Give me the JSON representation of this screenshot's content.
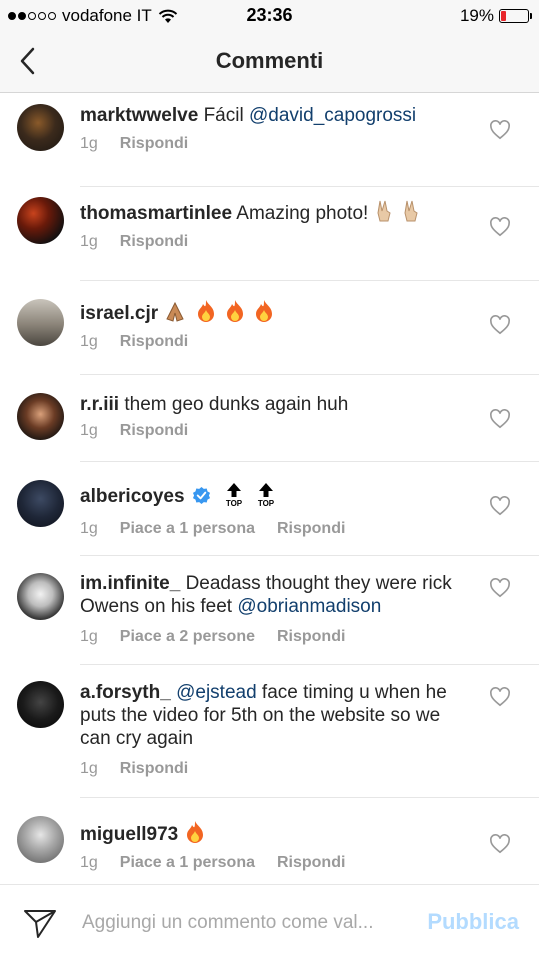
{
  "status_bar": {
    "carrier": "vodafone IT",
    "time": "23:36",
    "battery": "19%",
    "signal_bars": 2,
    "battery_level": 0.19,
    "battery_color": "#e8262b"
  },
  "nav": {
    "title": "Commenti",
    "back_icon": "chevron-left-icon"
  },
  "comments": [
    {
      "username": "marktwwelve",
      "text": "Fácil ",
      "mention": "@david_capogrossi",
      "time": "1g",
      "reply": "Rispondi"
    },
    {
      "username": "thomasmartinlee",
      "text": "Amazing photo!",
      "time": "1g",
      "reply": "Rispondi"
    },
    {
      "username": "israel.cjr",
      "time": "1g",
      "reply": "Rispondi"
    },
    {
      "username": "r.r.iii",
      "text": "them geo dunks again huh",
      "time": "1g",
      "reply": "Rispondi"
    },
    {
      "username": "albericoyes",
      "time": "1g",
      "likes": "Piace a 1 persona",
      "reply": "Rispondi",
      "top_label": "TOP"
    },
    {
      "username": "im.infinite_",
      "text": "Deadass thought they were rick Owens on his feet ",
      "mention": "@obrianmadison",
      "time": "1g",
      "likes": "Piace a 2 persone",
      "reply": "Rispondi"
    },
    {
      "username": "a.forsyth_",
      "mention": "@ejstead",
      "text": " face timing u when he puts the video for 5th on the website so we can cry again",
      "time": "1g",
      "reply": "Rispondi"
    },
    {
      "username": "miguell973",
      "time": "1g",
      "likes": "Piace a 1 persona",
      "reply": "Rispondi"
    }
  ],
  "composer": {
    "placeholder": "Aggiungi un commento come val...",
    "publish_label": "Pubblica",
    "send_icon": "direct-send-icon"
  },
  "colors": {
    "mention": "#123f6d",
    "publish_disabled": "#b3dbff",
    "meta_text": "#999999"
  }
}
